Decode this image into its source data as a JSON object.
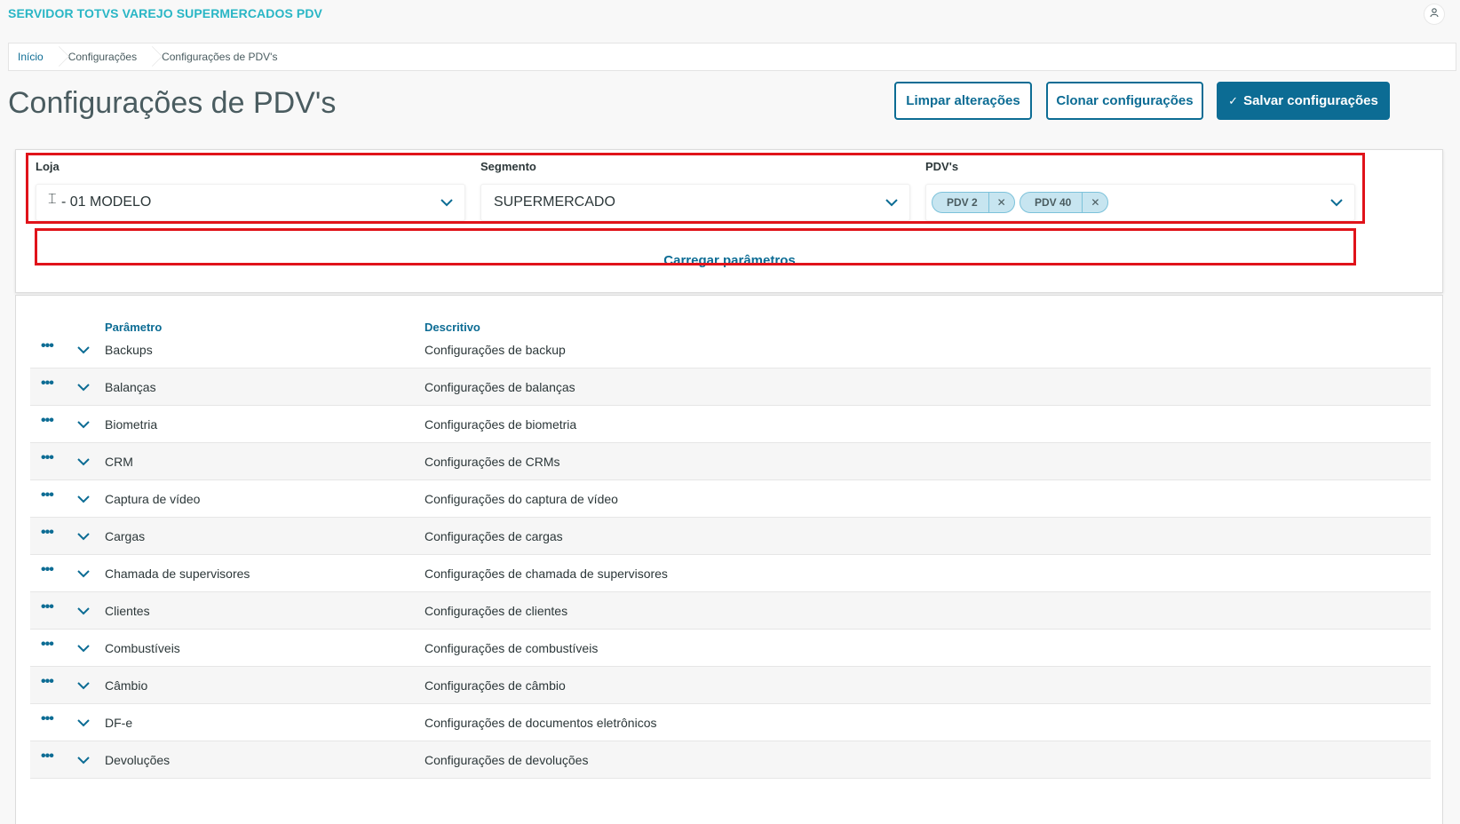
{
  "app": {
    "title": "SERVIDOR TOTVS VAREJO SUPERMERCADOS PDV"
  },
  "breadcrumb": [
    "Início",
    "Configurações",
    "Configurações de PDV's"
  ],
  "page": {
    "title": "Configurações de PDV's"
  },
  "actions": {
    "clear_label": "Limpar alterações",
    "clone_label": "Clonar configurações",
    "save_label": "Salvar configurações"
  },
  "filters": {
    "store_label": "Loja",
    "store_value": "- 01 MODELO",
    "segment_label": "Segmento",
    "segment_value": "SUPERMERCADO",
    "pdvs_label": "PDV's",
    "pdvs_selected": [
      "PDV 2",
      "PDV 40"
    ],
    "load_label": "Carregar parâmetros"
  },
  "table": {
    "headers": {
      "param": "Parâmetro",
      "desc": "Descritivo"
    },
    "rows": [
      {
        "param": "Backups",
        "desc": "Configurações de backup"
      },
      {
        "param": "Balanças",
        "desc": "Configurações de balanças"
      },
      {
        "param": "Biometria",
        "desc": "Configurações de biometria"
      },
      {
        "param": "CRM",
        "desc": "Configurações de CRMs"
      },
      {
        "param": "Captura de vídeo",
        "desc": "Configurações do captura de vídeo"
      },
      {
        "param": "Cargas",
        "desc": "Configurações de cargas"
      },
      {
        "param": "Chamada de supervisores",
        "desc": "Configurações de chamada de supervisores"
      },
      {
        "param": "Clientes",
        "desc": "Configurações de clientes"
      },
      {
        "param": "Combustíveis",
        "desc": "Configurações de combustíveis"
      },
      {
        "param": "Câmbio",
        "desc": "Configurações de câmbio"
      },
      {
        "param": "DF-e",
        "desc": "Configurações de documentos eletrônicos"
      },
      {
        "param": "Devoluções",
        "desc": "Configurações de devoluções"
      }
    ]
  },
  "colors": {
    "primary": "#0c6c94",
    "brand_title": "#29b6c5",
    "highlight": "#e0131a",
    "chip_bg": "#c7e5f0"
  },
  "icons": {
    "user": "user-icon",
    "chevron": "chevron-down-icon",
    "more": "more-dots-icon",
    "check": "check-icon",
    "remove": "close-icon"
  }
}
